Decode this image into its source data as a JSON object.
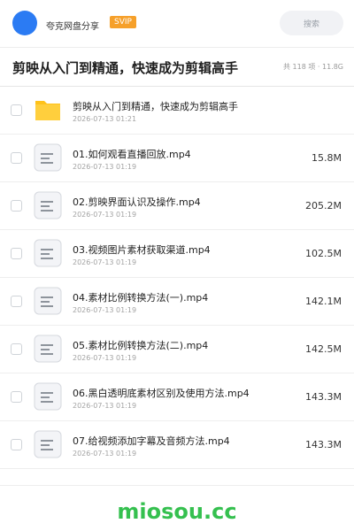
{
  "header": {
    "brand": "夸克网盘分享",
    "badge": "SVIP",
    "search_placeholder": "搜索"
  },
  "folder": {
    "title": "剪映从入门到精通，快速成为剪辑高手",
    "meta": "共 118 项 · 11.8G"
  },
  "items": [
    {
      "name": "剪映从入门到精通，快速成为剪辑高手",
      "date": "2026-07-13 01:21",
      "size": "",
      "type": "folder"
    },
    {
      "name": "01.如何观看直播回放.mp4",
      "date": "2026-07-13 01:19",
      "size": "15.8M",
      "type": "file"
    },
    {
      "name": "02.剪映界面认识及操作.mp4",
      "date": "2026-07-13 01:19",
      "size": "205.2M",
      "type": "file"
    },
    {
      "name": "03.视频图片素材获取渠道.mp4",
      "date": "2026-07-13 01:19",
      "size": "102.5M",
      "type": "file"
    },
    {
      "name": "04.素材比例转换方法(一).mp4",
      "date": "2026-07-13 01:19",
      "size": "142.1M",
      "type": "file"
    },
    {
      "name": "05.素材比例转换方法(二).mp4",
      "date": "2026-07-13 01:19",
      "size": "142.5M",
      "type": "file"
    },
    {
      "name": "06.黑白透明底素材区别及使用方法.mp4",
      "date": "2026-07-13 01:19",
      "size": "143.3M",
      "type": "file"
    },
    {
      "name": "07.给视频添加字幕及音频方法.mp4",
      "date": "2026-07-13 01:19",
      "size": "143.3M",
      "type": "file"
    }
  ],
  "watermark": "miosou.cc",
  "colors": {
    "avatar": "#2b7bf3",
    "badge": "#f6a02a",
    "folder": "#ffc21a",
    "watermark": "#35c04f"
  }
}
